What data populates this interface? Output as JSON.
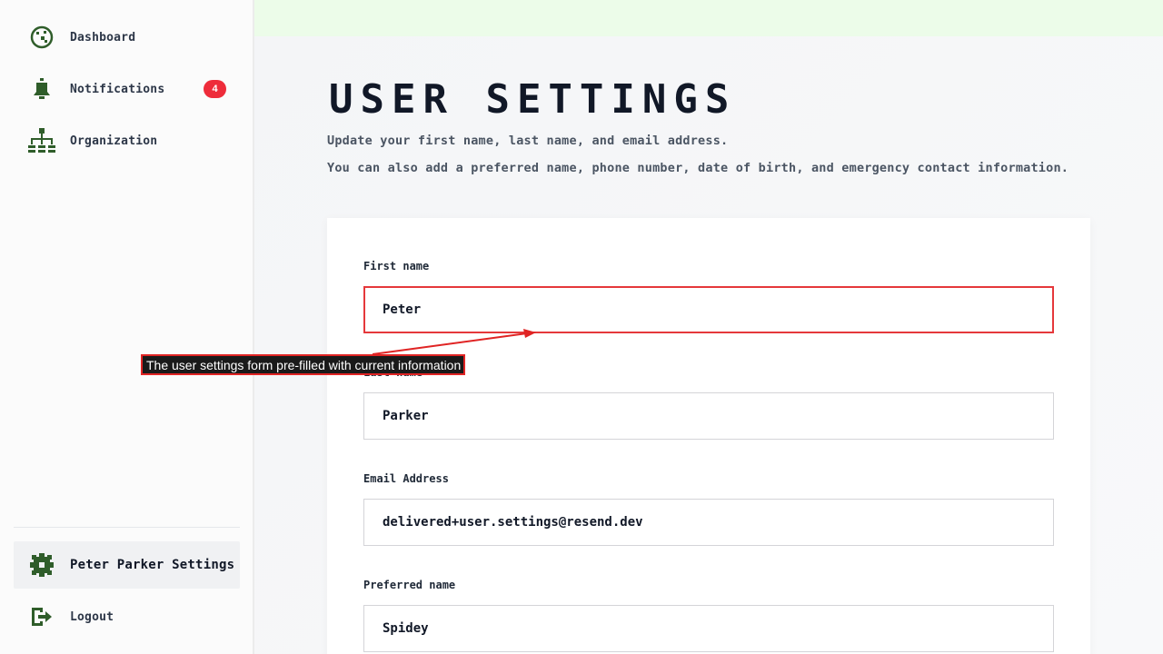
{
  "sidebar": {
    "items": [
      {
        "label": "Dashboard",
        "icon": "dashboard-icon"
      },
      {
        "label": "Notifications",
        "icon": "bell-icon",
        "badge": "4"
      },
      {
        "label": "Organization",
        "icon": "org-chart-icon"
      }
    ],
    "settings": {
      "label": "Peter Parker Settings",
      "icon": "gear-icon"
    },
    "logout": {
      "label": "Logout",
      "icon": "logout-icon"
    }
  },
  "page": {
    "title": "USER SETTINGS",
    "subtitle_1": "Update your first name, last name, and email address.",
    "subtitle_2": "You can also add a preferred name, phone number, date of birth, and emergency contact information."
  },
  "form": {
    "first_name": {
      "label": "First name",
      "value": "Peter"
    },
    "last_name": {
      "label": "Last name",
      "value": "Parker"
    },
    "email": {
      "label": "Email Address",
      "value": "delivered+user.settings@resend.dev"
    },
    "preferred_name": {
      "label": "Preferred name",
      "value": "Spidey"
    }
  },
  "annotation": {
    "text": "The user settings form pre-filled with current information"
  },
  "colors": {
    "accent_green": "#2f5d2a",
    "badge_red": "#ee2c3a",
    "banner_green": "#ecfce9",
    "annotation_red": "#e02424"
  }
}
